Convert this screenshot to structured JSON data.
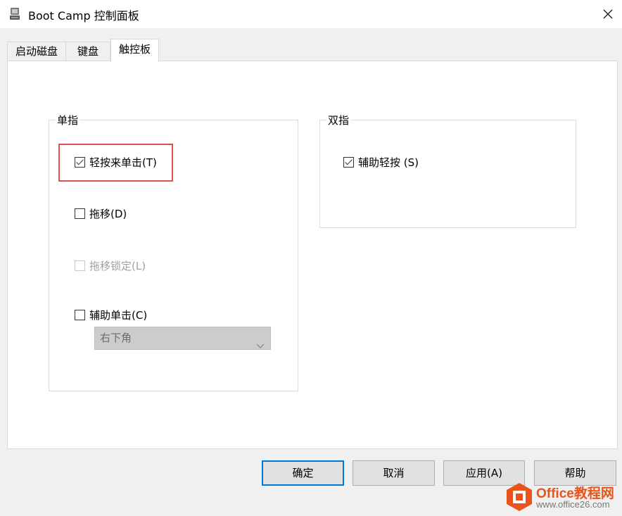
{
  "window": {
    "title": "Boot Camp 控制面板",
    "icons": {
      "app": "boot-camp-icon",
      "close": "close-icon"
    }
  },
  "tabs": [
    {
      "label": "启动磁盘",
      "active": false
    },
    {
      "label": "键盘",
      "active": false
    },
    {
      "label": "触控板",
      "active": true
    }
  ],
  "single_finger": {
    "title": "单指",
    "tap_to_click": {
      "label": "轻按来单击(T)",
      "checked": true,
      "enabled": true
    },
    "dragging": {
      "label": "拖移(D)",
      "checked": false,
      "enabled": true
    },
    "drag_lock": {
      "label": "拖移锁定(L)",
      "checked": false,
      "enabled": false
    },
    "secondary_click": {
      "label": "辅助单击(C)",
      "checked": false,
      "enabled": true
    },
    "secondary_click_corner": {
      "value": "右下角",
      "enabled": false
    }
  },
  "two_finger": {
    "title": "双指",
    "secondary_tap": {
      "label": "辅助轻按 (S)",
      "checked": true,
      "enabled": true
    }
  },
  "buttons": {
    "ok": "确定",
    "cancel": "取消",
    "apply": "应用(A)",
    "help": "帮助"
  },
  "watermark": {
    "brand": "Office教程网",
    "url": "www.office26.com"
  },
  "colors": {
    "highlight_box": "#d9534f",
    "default_button_border": "#0078d7",
    "watermark_orange": "#e8541b"
  }
}
